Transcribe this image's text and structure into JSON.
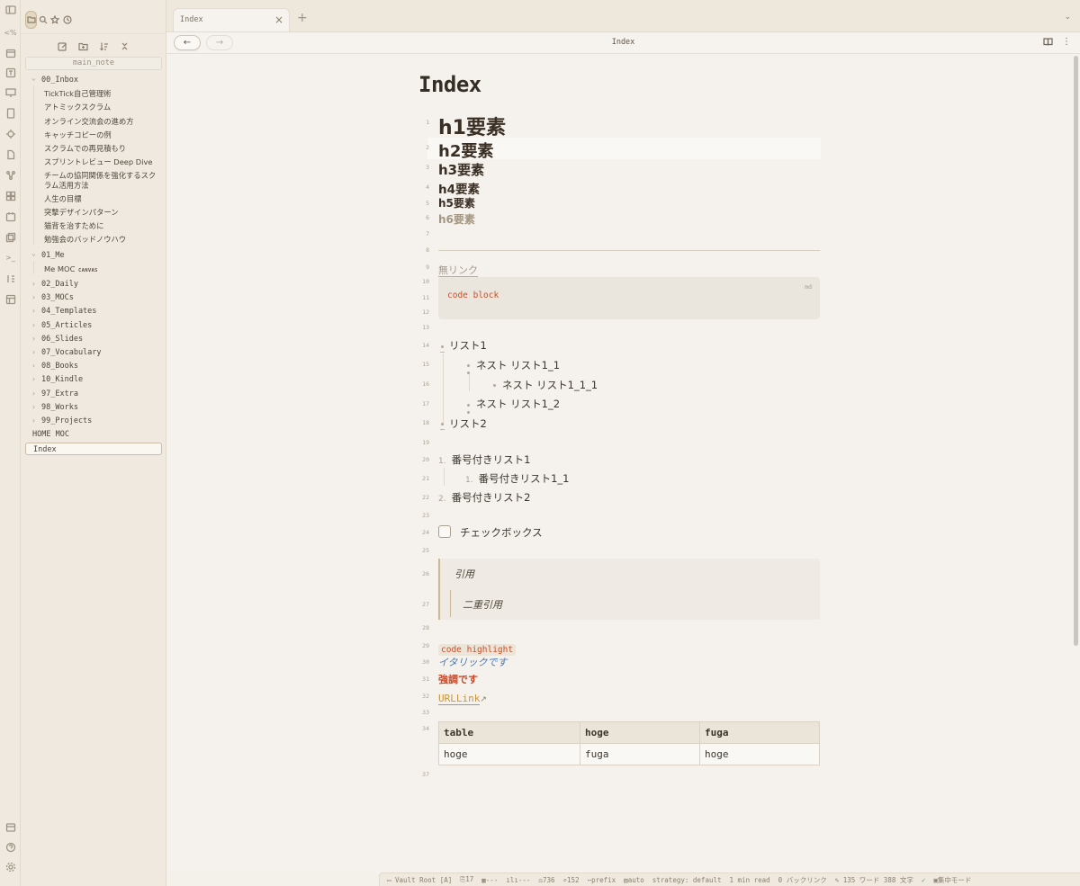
{
  "ribbon": {
    "icons": [
      "sidebar-toggle-icon",
      "command-icon",
      "calendar-icon",
      "template-icon",
      "presentation-icon",
      "bookmark-icon",
      "plugin-icon",
      "daily-note-icon",
      "graph-icon",
      "grid-icon",
      "calendar-2-icon",
      "copy-icon",
      "terminal-icon",
      "sort-icon",
      "layout-icon",
      "bottom-icons"
    ],
    "command_glyph": "<%",
    "terminal_glyph": ">_"
  },
  "sidebar": {
    "vault_name": "main_note",
    "tree": [
      {
        "type": "folder",
        "label": "00_Inbox",
        "expanded": true
      },
      {
        "type": "child",
        "label": "TickTick自己管理術"
      },
      {
        "type": "child",
        "label": "アトミックスクラム"
      },
      {
        "type": "child",
        "label": "オンライン交流会の進め方"
      },
      {
        "type": "child",
        "label": "キャッチコピーの例"
      },
      {
        "type": "child",
        "label": "スクラムでの再見積もり"
      },
      {
        "type": "child",
        "label": "スプリントレビュー Deep Dive"
      },
      {
        "type": "child",
        "label": "チームの協同関係を強化するスク"
      },
      {
        "type": "child-cont",
        "label": "ラム活用方法"
      },
      {
        "type": "child",
        "label": "人生の目標"
      },
      {
        "type": "child",
        "label": "突撃デザインパターン"
      },
      {
        "type": "child",
        "label": "猫背を治すために"
      },
      {
        "type": "child",
        "label": "勉強会のバッドノウハウ"
      },
      {
        "type": "folder",
        "label": "01_Me",
        "expanded": true
      },
      {
        "type": "child",
        "label": "Me MOC",
        "badge": "CANVAS"
      },
      {
        "type": "folder",
        "label": "02_Daily"
      },
      {
        "type": "folder",
        "label": "03_MOCs"
      },
      {
        "type": "folder",
        "label": "04_Templates"
      },
      {
        "type": "folder",
        "label": "05_Articles"
      },
      {
        "type": "folder",
        "label": "06_Slides"
      },
      {
        "type": "folder",
        "label": "07_Vocabulary"
      },
      {
        "type": "folder",
        "label": "08_Books"
      },
      {
        "type": "folder",
        "label": "10_Kindle"
      },
      {
        "type": "folder",
        "label": "97_Extra"
      },
      {
        "type": "folder",
        "label": "98_Works"
      },
      {
        "type": "folder",
        "label": "99_Projects"
      },
      {
        "type": "root",
        "label": "HOME MOC"
      },
      {
        "type": "root-selected",
        "label": "Index"
      }
    ]
  },
  "tabs": {
    "active_title": "Index",
    "close_glyph": "×",
    "add_glyph": "+",
    "list_glyph": "⌄"
  },
  "header": {
    "back_glyph": "←",
    "forward_glyph": "→",
    "title": "Index",
    "more_glyph": "⋮"
  },
  "editor": {
    "title": "Index",
    "line_numbers": [
      "1",
      "2",
      "3",
      "4",
      "5",
      "6",
      "7",
      "8",
      "9",
      "10",
      "11",
      "12",
      "13",
      "14",
      "15",
      "16",
      "17",
      "18",
      "19",
      "20",
      "21",
      "22",
      "23",
      "24",
      "25",
      "26",
      "27",
      "28",
      "29",
      "30",
      "31",
      "32",
      "33",
      "34",
      "37"
    ],
    "h1": "h1要素",
    "h2": "h2要素",
    "h3": "h3要素",
    "h4": "h4要素",
    "h5": "h5要素",
    "h6": "h6要素",
    "unresolved_link": "無リンク",
    "code_lang": "md",
    "code_text": "code block",
    "list": [
      "リスト1",
      "ネスト リスト1_1",
      "ネスト リスト1_1_1",
      "ネスト リスト1_2",
      "リスト2"
    ],
    "ordered": [
      {
        "num": "1.",
        "text": "番号付きリスト1"
      },
      {
        "num": "1.",
        "text": "番号付きリスト1_1"
      },
      {
        "num": "2.",
        "text": "番号付きリスト2"
      }
    ],
    "checkbox": "チェックボックス",
    "quote": "引用",
    "quote_nested": "二重引用",
    "inline_code": "code highlight",
    "italic": "イタリックです",
    "strong": "強調です",
    "url_link": "URLLink",
    "ext_glyph": "↗",
    "table": {
      "headers": [
        "table",
        "hoge",
        "fuga"
      ],
      "rows": [
        [
          "hoge",
          "fuga",
          "hoge"
        ]
      ]
    }
  },
  "statusbar": {
    "vault_root": "Vault Root  [A]",
    "backlinks_count": "17",
    "s2": "---",
    "s3": "---",
    "s4": "736",
    "s5": "152",
    "prefix": "prefix",
    "auto": "auto",
    "strategy": "strategy: default",
    "read_time": "1 min read",
    "backlinks": "0 バックリンク",
    "words": "135 ワード 388 文字",
    "focus_mode": "集中モード"
  }
}
